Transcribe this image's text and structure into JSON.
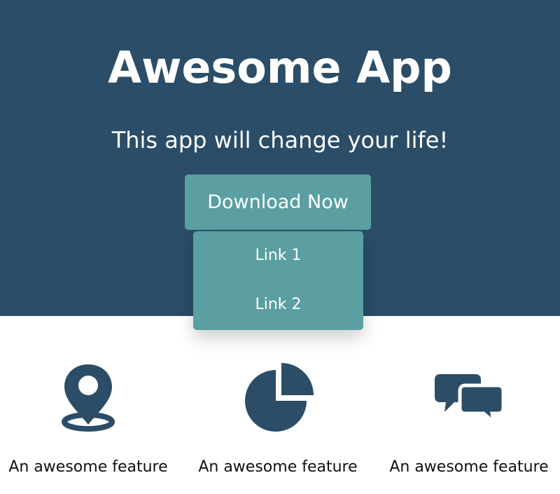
{
  "hero": {
    "title": "Awesome App",
    "subtitle": "This app will change your life!",
    "background_color": "#2b4d67",
    "download_button": {
      "label": "Download Now",
      "color": "#5b9fa2"
    },
    "dropdown": {
      "items": [
        {
          "label": "Link 1"
        },
        {
          "label": "Link 2"
        }
      ]
    }
  },
  "features": [
    {
      "icon": "map-pin-icon",
      "label": "An awesome feature"
    },
    {
      "icon": "pie-chart-icon",
      "label": "An awesome feature"
    },
    {
      "icon": "chat-bubbles-icon",
      "label": "An awesome feature"
    }
  ],
  "colors": {
    "icon": "#2b4d67",
    "text": "#111111"
  }
}
